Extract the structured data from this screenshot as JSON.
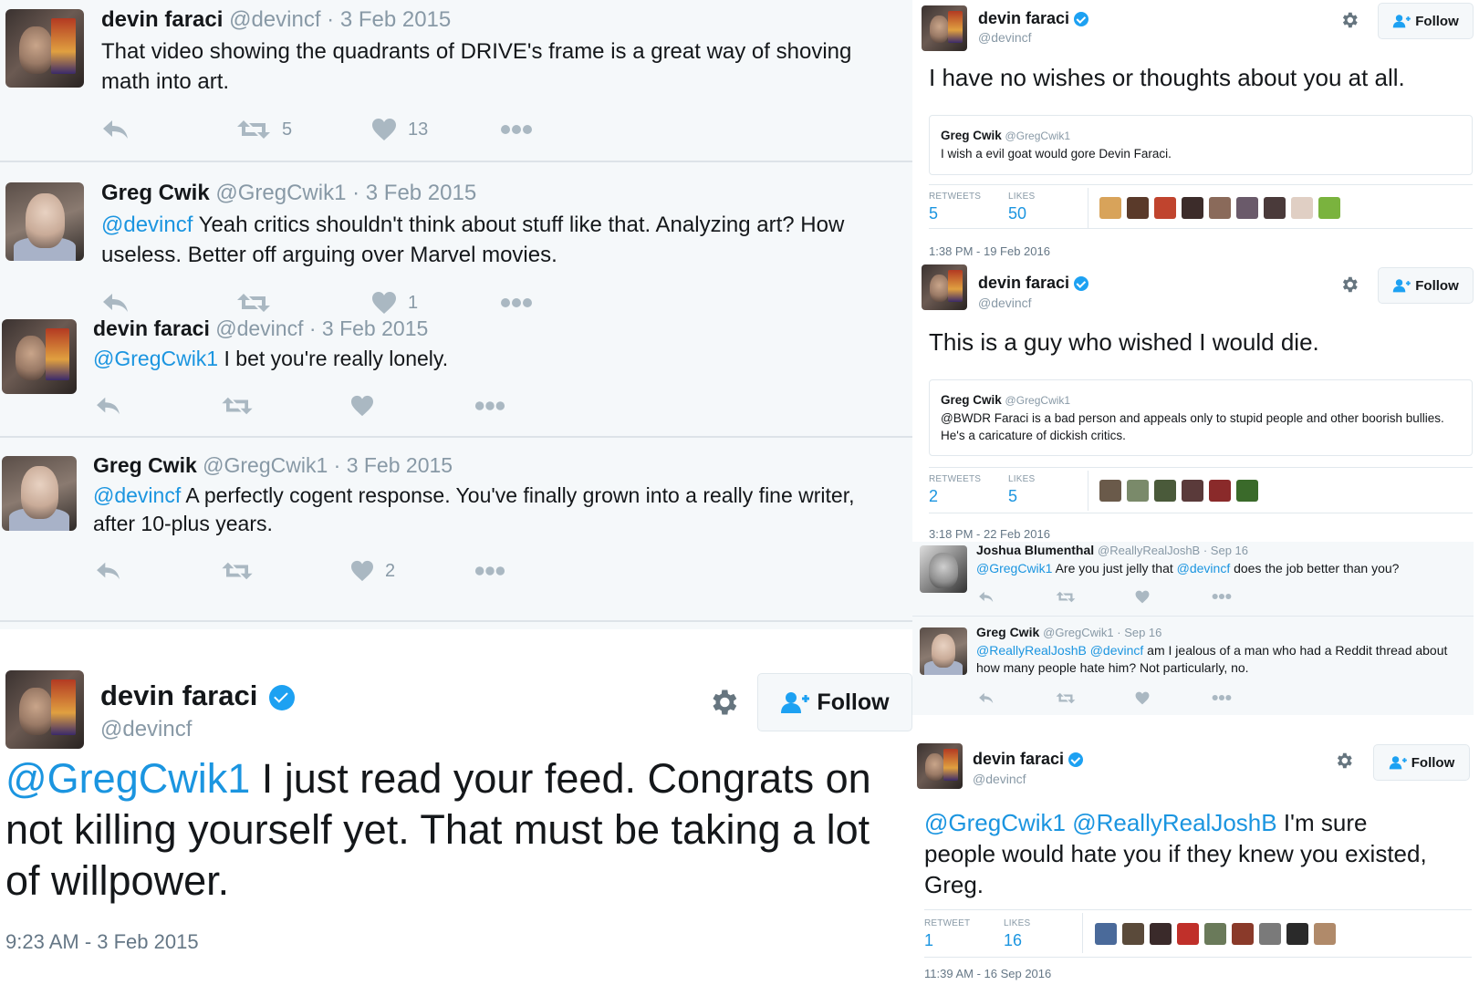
{
  "left_thread": {
    "tweets": [
      {
        "name": "devin faraci",
        "handle": "@devincf",
        "date": " · 3 Feb 2015",
        "text": "That video showing the quadrants of DRIVE's frame is a great way of shoving math into art.",
        "mention": "",
        "retweets": "5",
        "likes": "13"
      },
      {
        "name": "Greg Cwik",
        "handle": "@GregCwik1",
        "date": " · 3 Feb 2015",
        "mention": "@devincf",
        "text": " Yeah critics shouldn't think about stuff like that. Analyzing art? How useless. Better off arguing over Marvel movies.",
        "retweets": "",
        "likes": "1"
      },
      {
        "name": "devin faraci",
        "handle": "@devincf",
        "date": " · 3 Feb 2015",
        "mention": "@GregCwik1",
        "text": " I bet you're really lonely.",
        "retweets": "",
        "likes": ""
      },
      {
        "name": "Greg Cwik",
        "handle": "@GregCwik1",
        "date": " · 3 Feb 2015",
        "mention": "@devincf",
        "text": " A perfectly cogent response. You've finally grown into a really fine writer, after 10-plus years.",
        "retweets": "",
        "likes": "2"
      }
    ]
  },
  "left_big": {
    "name": "devin faraci",
    "handle": "@devincf",
    "follow_label": "Follow",
    "mention": "@GregCwik1",
    "text": " I just read your feed. Congrats on not killing yourself yet. That must be taking a lot of willpower.",
    "timestamp": "9:23 AM - 3 Feb 2015"
  },
  "right_top": {
    "name": "devin faraci",
    "handle": "@devincf",
    "follow_label": "Follow",
    "text": "I have no wishes or thoughts about you at all.",
    "quote": {
      "name": "Greg Cwik",
      "handle": "@GregCwik1",
      "text": "I wish a evil goat would gore Devin Faraci."
    },
    "retweets_label": "RETWEETS",
    "retweets": "5",
    "likes_label": "LIKES",
    "likes": "50",
    "timestamp": "1:38 PM - 19 Feb 2016"
  },
  "right_mid": {
    "name": "devin faraci",
    "handle": "@devincf",
    "follow_label": "Follow",
    "text": "This is a guy who wished I would die.",
    "quote": {
      "name": "Greg Cwik",
      "handle": "@GregCwik1",
      "text": "@BWDR  Faraci is a bad person and appeals only to stupid people and other boorish bullies.  He's a caricature of dickish critics."
    },
    "retweets_label": "RETWEETS",
    "retweets": "2",
    "likes_label": "LIKES",
    "likes": "5",
    "timestamp": "3:18 PM - 22 Feb 2016"
  },
  "right_replies": [
    {
      "name": "Joshua Blumenthal",
      "handle": "@ReallyRealJoshB",
      "date": " · Sep 16",
      "mention1": "@GregCwik1",
      "text1": " Are you just jelly that ",
      "mention2": "@devincf",
      "text2": " does the job better than you?"
    },
    {
      "name": "Greg Cwik",
      "handle": "@GregCwik1",
      "date": " · Sep 16",
      "mention1": "@ReallyRealJoshB",
      "text1": " ",
      "mention2": "@devincf",
      "text2": " am I jealous of a man who had a Reddit thread about how many people hate him? Not particularly, no."
    }
  ],
  "right_bottom": {
    "name": "devin faraci",
    "handle": "@devincf",
    "follow_label": "Follow",
    "mention1": "@GregCwik1",
    "mention2": "@ReallyRealJoshB",
    "text": " I'm sure people would hate you if they knew you existed, Greg.",
    "retweets_label": "RETWEET",
    "retweets": "1",
    "likes_label": "LIKES",
    "likes": "16",
    "timestamp": "11:39 AM - 16 Sep 2016"
  },
  "icons": [
    "reply-icon",
    "retweet-icon",
    "heart-icon",
    "more-icon",
    "gear-icon",
    "follow-person-icon",
    "verified-icon"
  ],
  "colors": {
    "link": "#1b95e0",
    "verified": "#1da1f2",
    "muted": "#8899a6",
    "icon": "#aab8c2",
    "panel": "#f5f8fa"
  }
}
